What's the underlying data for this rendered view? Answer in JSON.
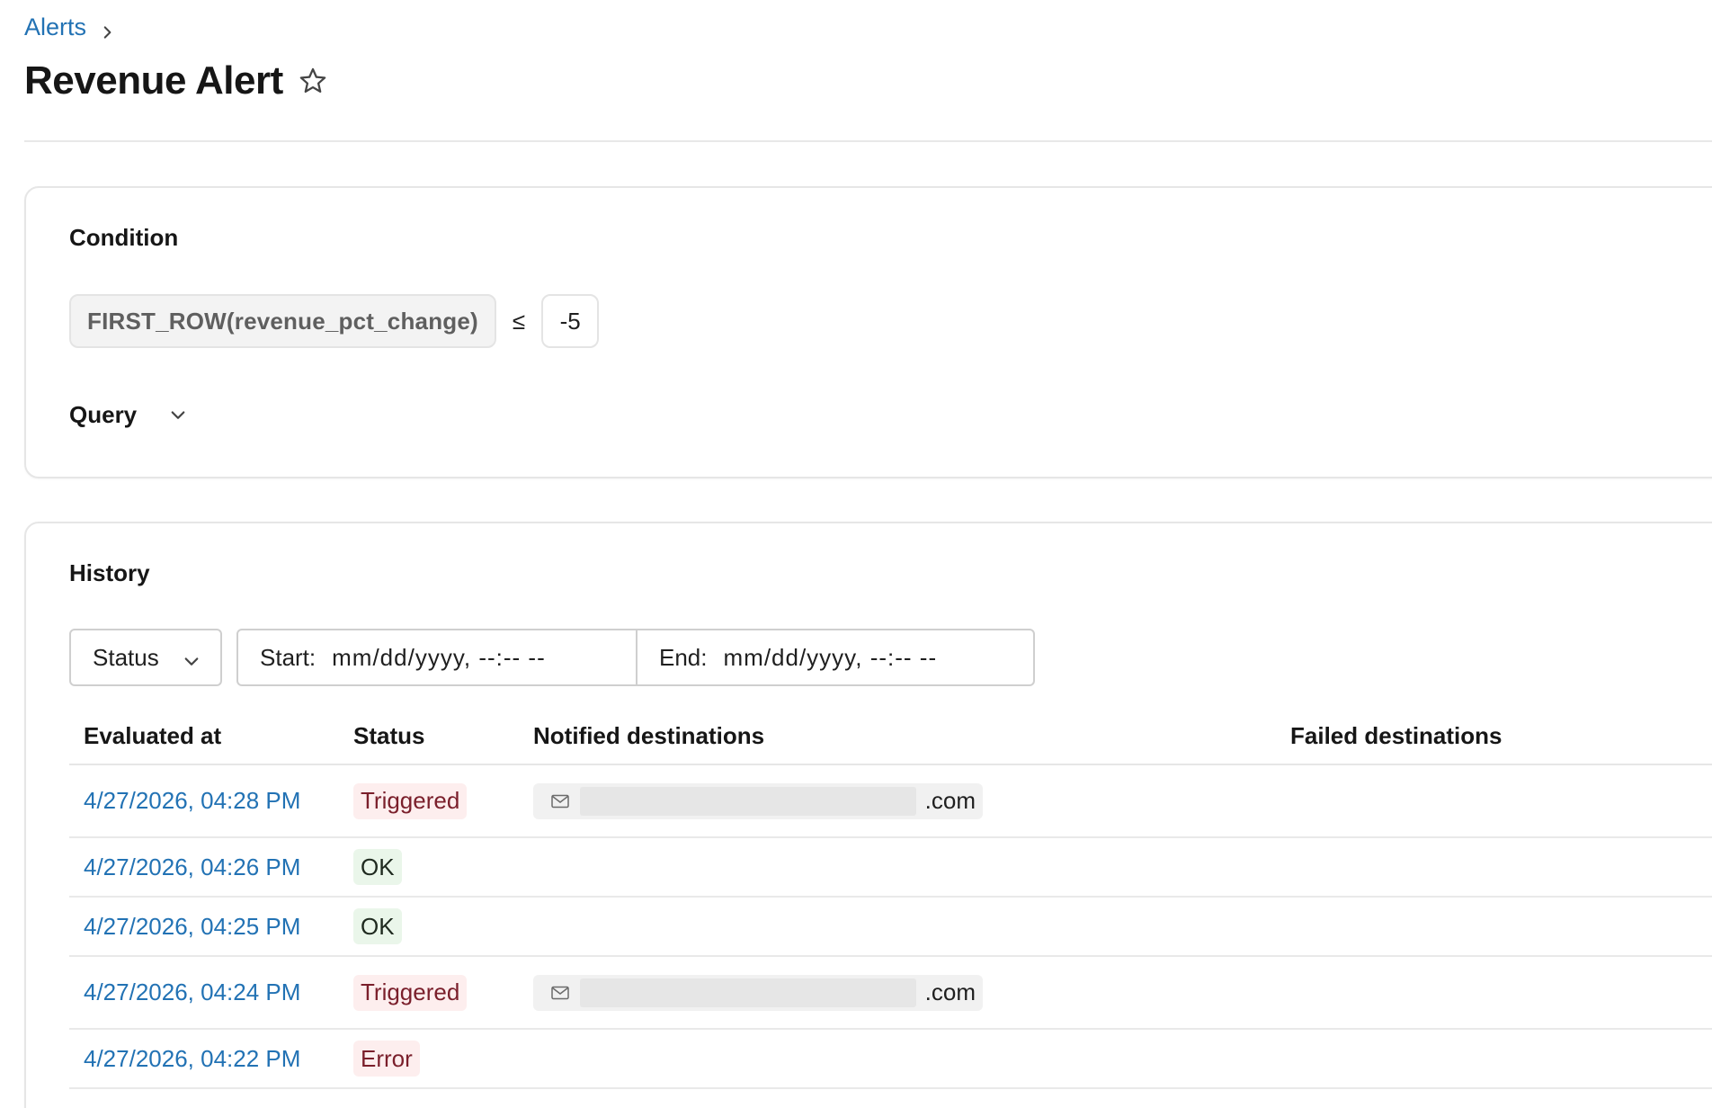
{
  "breadcrumb": {
    "items": [
      "Alerts"
    ]
  },
  "page": {
    "title": "Revenue Alert"
  },
  "condition": {
    "heading": "Condition",
    "expression": "FIRST_ROW(revenue_pct_change)",
    "operator": "≤",
    "threshold": "-5",
    "query_label": "Query"
  },
  "history": {
    "heading": "History",
    "filters": {
      "status_label": "Status",
      "start_label": "Start:",
      "start_placeholder": "mm/dd/yyyy, --:-- --",
      "end_label": "End:",
      "end_placeholder": "mm/dd/yyyy, --:-- --"
    },
    "columns": [
      "Evaluated at",
      "Status",
      "Notified destinations",
      "Failed destinations"
    ],
    "rows": [
      {
        "evaluated_at": "4/27/2026, 04:28 PM",
        "status": "Triggered",
        "status_kind": "triggered",
        "notified": ".com",
        "failed": ""
      },
      {
        "evaluated_at": "4/27/2026, 04:26 PM",
        "status": "OK",
        "status_kind": "ok",
        "notified": "",
        "failed": ""
      },
      {
        "evaluated_at": "4/27/2026, 04:25 PM",
        "status": "OK",
        "status_kind": "ok",
        "notified": "",
        "failed": ""
      },
      {
        "evaluated_at": "4/27/2026, 04:24 PM",
        "status": "Triggered",
        "status_kind": "triggered",
        "notified": ".com",
        "failed": ""
      },
      {
        "evaluated_at": "4/27/2026, 04:22 PM",
        "status": "Error",
        "status_kind": "error",
        "notified": "",
        "failed": ""
      }
    ]
  },
  "icons": {
    "breadcrumb_separator": "chevron-right-icon",
    "favorite": "star-icon",
    "query_toggle": "chevron-down-icon",
    "status_dropdown": "chevron-down-icon",
    "destination": "mail-icon"
  },
  "colors": {
    "link": "#2272b4",
    "triggered_bg": "#fdeeee",
    "triggered_fg": "#7a1f2b",
    "ok_bg": "#eaf6ea",
    "chip_bg": "#f1f1f1"
  }
}
